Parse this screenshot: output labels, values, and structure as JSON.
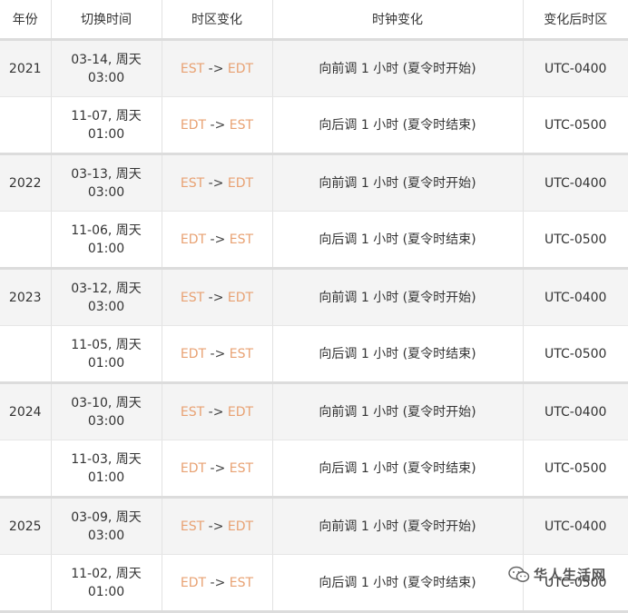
{
  "headers": [
    "年份",
    "切换时间",
    "时区变化",
    "时钟变化",
    "变化后时区"
  ],
  "arrow": "->",
  "rows": [
    {
      "year": "2021",
      "date": "03-14, 周天",
      "time": "03:00",
      "from": "EST",
      "to": "EDT",
      "change": "向前调 1 小时 (夏令时开始)",
      "zone": "UTC-0400"
    },
    {
      "year": "",
      "date": "11-07, 周天",
      "time": "01:00",
      "from": "EDT",
      "to": "EST",
      "change": "向后调 1 小时 (夏令时结束)",
      "zone": "UTC-0500"
    },
    {
      "year": "2022",
      "date": "03-13, 周天",
      "time": "03:00",
      "from": "EST",
      "to": "EDT",
      "change": "向前调 1 小时 (夏令时开始)",
      "zone": "UTC-0400"
    },
    {
      "year": "",
      "date": "11-06, 周天",
      "time": "01:00",
      "from": "EDT",
      "to": "EST",
      "change": "向后调 1 小时 (夏令时结束)",
      "zone": "UTC-0500"
    },
    {
      "year": "2023",
      "date": "03-12, 周天",
      "time": "03:00",
      "from": "EST",
      "to": "EDT",
      "change": "向前调 1 小时 (夏令时开始)",
      "zone": "UTC-0400"
    },
    {
      "year": "",
      "date": "11-05, 周天",
      "time": "01:00",
      "from": "EDT",
      "to": "EST",
      "change": "向后调 1 小时 (夏令时结束)",
      "zone": "UTC-0500"
    },
    {
      "year": "2024",
      "date": "03-10, 周天",
      "time": "03:00",
      "from": "EST",
      "to": "EDT",
      "change": "向前调 1 小时 (夏令时开始)",
      "zone": "UTC-0400"
    },
    {
      "year": "",
      "date": "11-03, 周天",
      "time": "01:00",
      "from": "EDT",
      "to": "EST",
      "change": "向后调 1 小时 (夏令时结束)",
      "zone": "UTC-0500"
    },
    {
      "year": "2025",
      "date": "03-09, 周天",
      "time": "03:00",
      "from": "EST",
      "to": "EDT",
      "change": "向前调 1 小时 (夏令时开始)",
      "zone": "UTC-0400"
    },
    {
      "year": "",
      "date": "11-02, 周天",
      "time": "01:00",
      "from": "EDT",
      "to": "EST",
      "change": "向后调 1 小时 (夏令时结束)",
      "zone": "UTC-0500"
    }
  ],
  "watermark": {
    "text": "华人生活网",
    "icon": "wechat-logo-icon"
  },
  "colors": {
    "timezone_accent": "#e8a172",
    "shaded_row": "#f4f4f4"
  }
}
